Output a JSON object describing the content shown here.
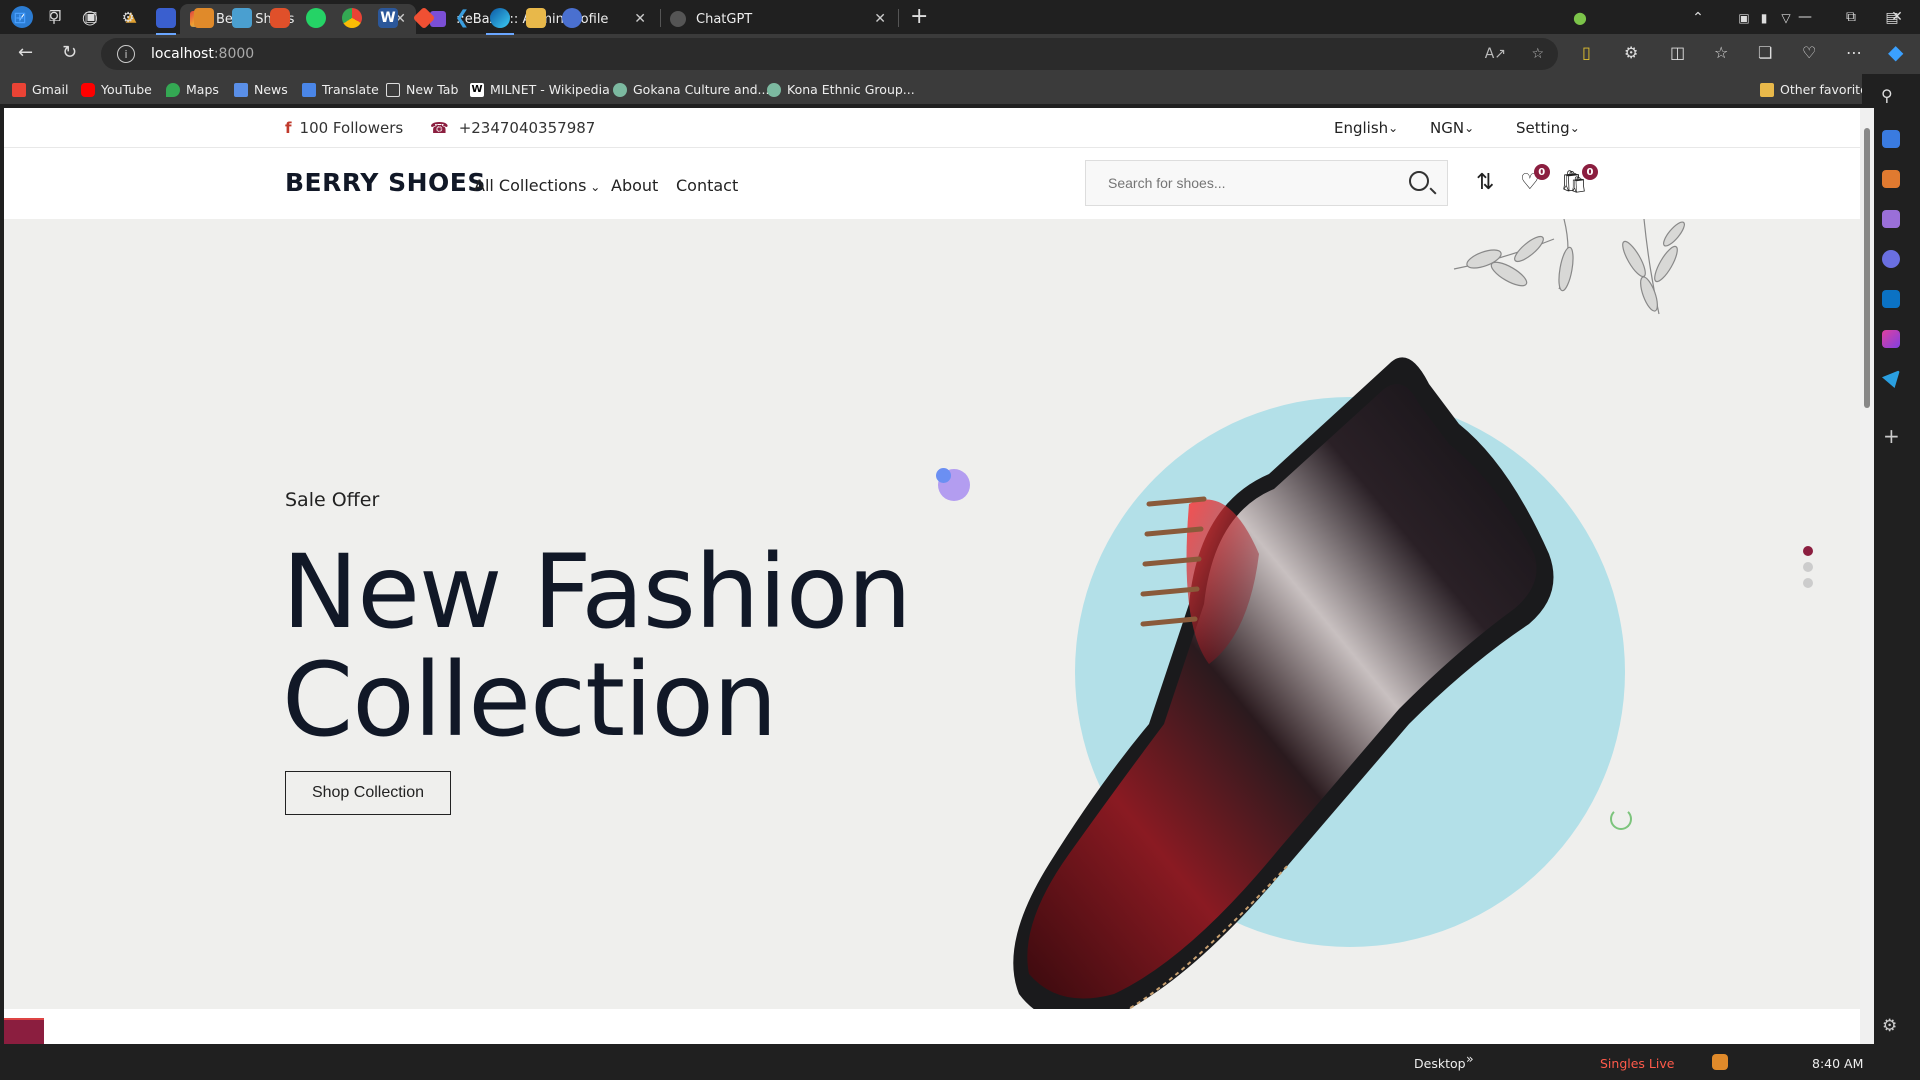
{
  "browser": {
    "tabs": [
      {
        "label": "Berry Shoes",
        "active": true
      },
      {
        "label": "::eBazar:: Admin Profile",
        "active": false
      },
      {
        "label": "ChatGPT",
        "active": false
      }
    ],
    "url": {
      "host": "localhost",
      "port": ":8000"
    },
    "bookmarks": [
      "Gmail",
      "YouTube",
      "Maps",
      "News",
      "Translate",
      "New Tab",
      "MILNET - Wikipedia",
      "Gokana Culture and...",
      "Kona Ethnic Group..."
    ],
    "other_favorites": "Other favorites"
  },
  "site": {
    "topbar": {
      "followers": "100 Followers",
      "phone": "+2347040357987",
      "language": "English",
      "currency": "NGN",
      "setting": "Setting"
    },
    "header": {
      "logo": "BERRY SHOES",
      "nav": [
        "All Collections",
        "About",
        "Contact"
      ],
      "search_placeholder": "Search for shoes...",
      "wishlist_count": "0",
      "cart_count": "0"
    },
    "hero": {
      "eyebrow": "Sale Offer",
      "title_line1": "New Fashion",
      "title_line2": "Collection",
      "cta": "Shop Collection",
      "slides": 3,
      "active_slide": 1
    }
  },
  "taskbar": {
    "desktop_label": "Desktop",
    "singles_live": "Singles Live",
    "time": "8:40 AM"
  },
  "colors": {
    "accent": "#8b1e3f",
    "hero_bg": "#efefed",
    "circle": "#b3e0e8",
    "text_dark": "#111827"
  }
}
